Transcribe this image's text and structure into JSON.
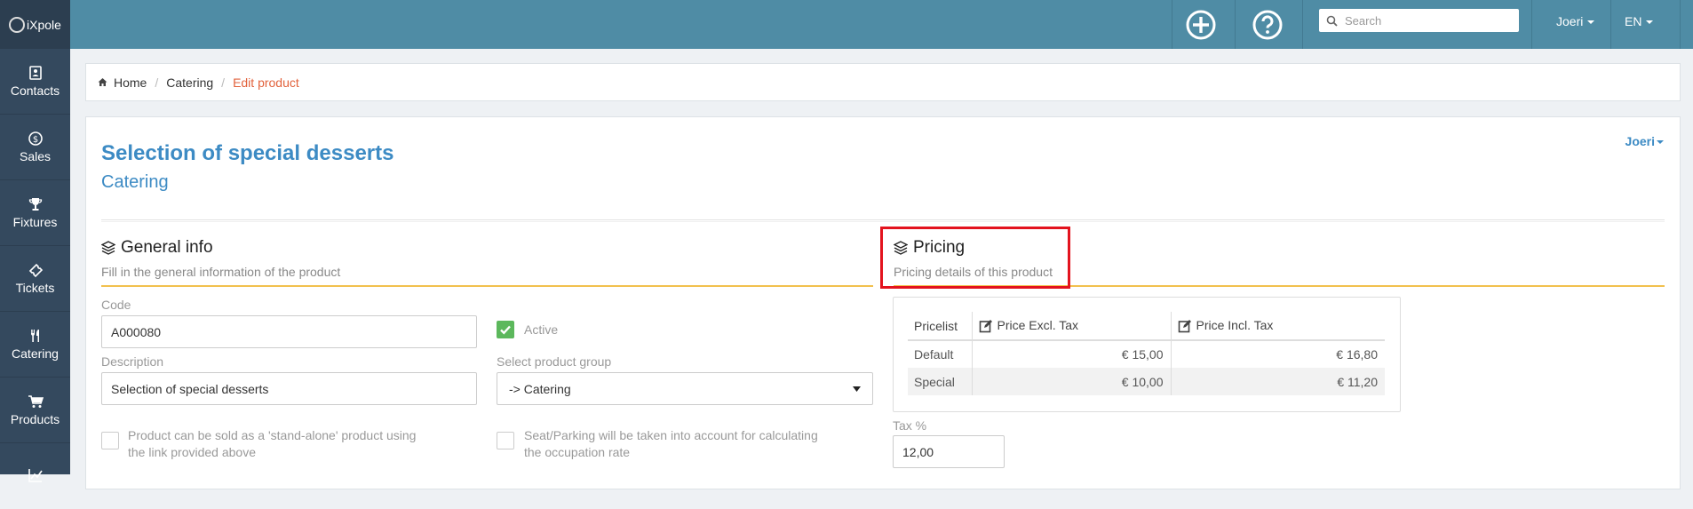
{
  "app": {
    "logo_text": "iXpole"
  },
  "sidebar": {
    "items": [
      {
        "label": "Contacts",
        "icon": "contact-card-icon"
      },
      {
        "label": "Sales",
        "icon": "dollar-circle-icon"
      },
      {
        "label": "Fixtures",
        "icon": "trophy-icon"
      },
      {
        "label": "Tickets",
        "icon": "ticket-icon"
      },
      {
        "label": "Catering",
        "icon": "cutlery-icon"
      },
      {
        "label": "Products",
        "icon": "cart-icon"
      },
      {
        "label": "",
        "icon": "chart-line-icon"
      }
    ]
  },
  "topbar": {
    "search_placeholder": "Search",
    "user": "Joeri",
    "language": "EN"
  },
  "breadcrumb": {
    "home": "Home",
    "section": "Catering",
    "current": "Edit product"
  },
  "page": {
    "title": "Selection of special desserts",
    "subtitle": "Catering",
    "user_dropdown": "Joeri"
  },
  "general": {
    "heading": "General info",
    "subheading": "Fill in the general information of the product",
    "code_label": "Code",
    "code_value": "A000080",
    "active_label": "Active",
    "active_checked": true,
    "description_label": "Description",
    "description_value": "Selection of special desserts",
    "group_label": "Select product group",
    "group_value": "-> Catering",
    "standalone_text_1": "Product can be sold as a 'stand-alone' product using",
    "standalone_text_2": "the link provided above",
    "seat_text_1": "Seat/Parking will be taken into account for calculating",
    "seat_text_2": "the occupation rate"
  },
  "pricing": {
    "heading": "Pricing",
    "subheading": "Pricing details of this product",
    "columns": [
      "Pricelist",
      "Price Excl. Tax",
      "Price Incl. Tax"
    ],
    "rows": [
      {
        "pricelist": "Default",
        "excl": "€ 15,00",
        "incl": "€ 16,80"
      },
      {
        "pricelist": "Special",
        "excl": "€ 10,00",
        "incl": "€ 11,20"
      }
    ],
    "tax_label": "Tax %",
    "tax_value": "12,00"
  },
  "colors": {
    "accent": "#3d8bc4",
    "topbar": "#4f8ca5",
    "sidebar": "#34495e",
    "highlight": "#e3131e",
    "breadcrumb_active": "#e2623c"
  }
}
